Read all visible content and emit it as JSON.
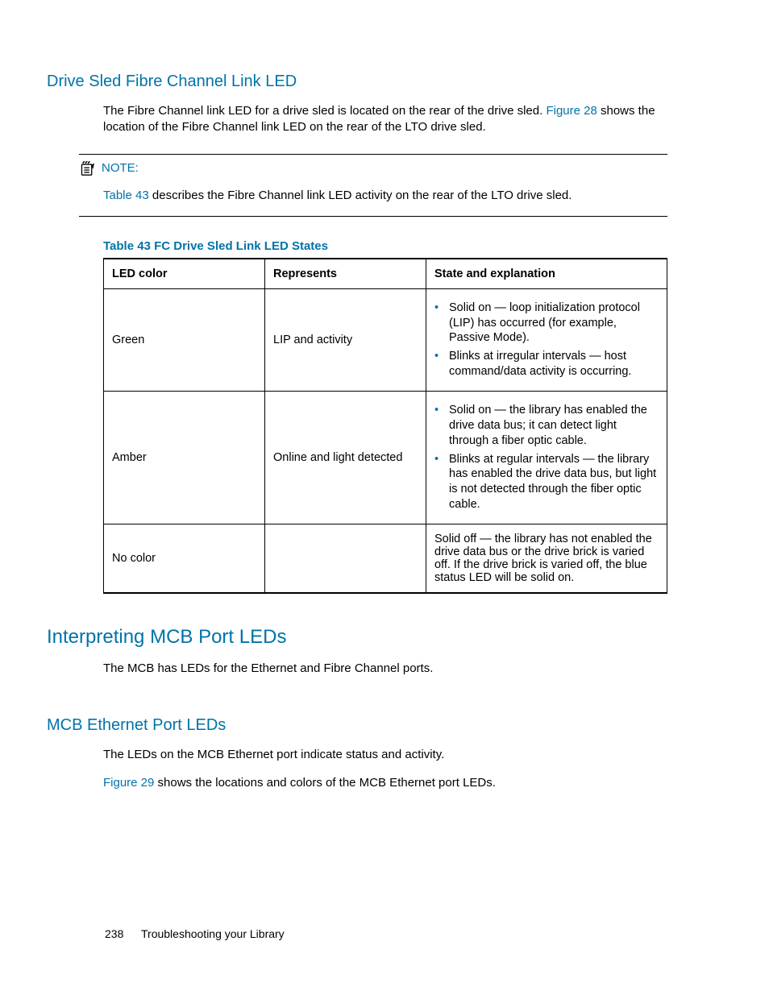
{
  "section1": {
    "heading": "Drive Sled Fibre Channel Link LED",
    "p1a": "The Fibre Channel link LED for a drive sled is located on the rear of the drive sled. ",
    "p1_link": "Figure 28",
    "p1b": " shows the location of the Fibre Channel link LED on the rear of the LTO drive sled."
  },
  "note": {
    "label": "NOTE:",
    "text_link": "Table 43",
    "text_rest": " describes the Fibre Channel link LED activity on the rear of the LTO drive sled."
  },
  "table": {
    "caption": "Table 43 FC Drive Sled Link LED States",
    "headers": [
      "LED color",
      "Represents",
      "State and explanation"
    ],
    "rows": [
      {
        "color": "Green",
        "rep": "LIP and activity",
        "bullets": [
          "Solid on — loop initialization protocol (LIP) has occurred (for example, Passive Mode).",
          "Blinks at irregular intervals — host command/data activity is occurring."
        ]
      },
      {
        "color": "Amber",
        "rep": "Online and light detected",
        "bullets": [
          "Solid on — the library has enabled the drive data bus; it can detect light through a fiber optic cable.",
          "Blinks at regular intervals — the library has enabled the drive data bus, but light is not detected through the fiber optic cable."
        ]
      },
      {
        "color": "No color",
        "rep": "",
        "plain": "Solid off — the library has not enabled the drive data bus or the drive brick is varied off. If the drive brick is varied off, the blue status LED will be solid on."
      }
    ]
  },
  "section2": {
    "heading": "Interpreting MCB Port LEDs",
    "p1": "The MCB has LEDs for the Ethernet and Fibre Channel ports."
  },
  "section3": {
    "heading": "MCB Ethernet Port LEDs",
    "p1": "The LEDs on the MCB Ethernet port indicate status and activity.",
    "p2_link": "Figure 29",
    "p2_rest": " shows the locations and colors of the MCB Ethernet port LEDs."
  },
  "footer": {
    "page": "238",
    "section": "Troubleshooting your Library"
  }
}
